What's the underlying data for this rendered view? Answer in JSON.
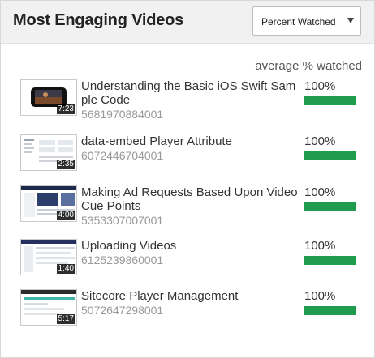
{
  "header": {
    "title": "Most Engaging Videos",
    "metric_select": {
      "selected": "Percent Watched"
    }
  },
  "column_label": "average % watched",
  "bar_color": "#1f9c4e",
  "videos": [
    {
      "title": "Understanding the Basic iOS Swift Sample Code",
      "id": "5681970884001",
      "duration": "7:23",
      "percent_label": "100%",
      "percent_value": 100,
      "thumb_icon": "iphone-video-thumbnail"
    },
    {
      "title": "data-embed Player Attribute",
      "id": "6072446704001",
      "duration": "2:35",
      "percent_label": "100%",
      "percent_value": 100,
      "thumb_icon": "code-page-thumbnail"
    },
    {
      "title": "Making Ad Requests Based Upon Video Cue Points",
      "id": "5353307007001",
      "duration": "4:00",
      "percent_label": "100%",
      "percent_value": 100,
      "thumb_icon": "studio-screen-thumbnail"
    },
    {
      "title": "Uploading Videos",
      "id": "6125239860001",
      "duration": "1:40",
      "percent_label": "100%",
      "percent_value": 100,
      "thumb_icon": "upload-screen-thumbnail"
    },
    {
      "title": "Sitecore Player Management",
      "id": "5072647298001",
      "duration": "5:17",
      "percent_label": "100%",
      "percent_value": 100,
      "thumb_icon": "sitecore-screen-thumbnail"
    }
  ]
}
